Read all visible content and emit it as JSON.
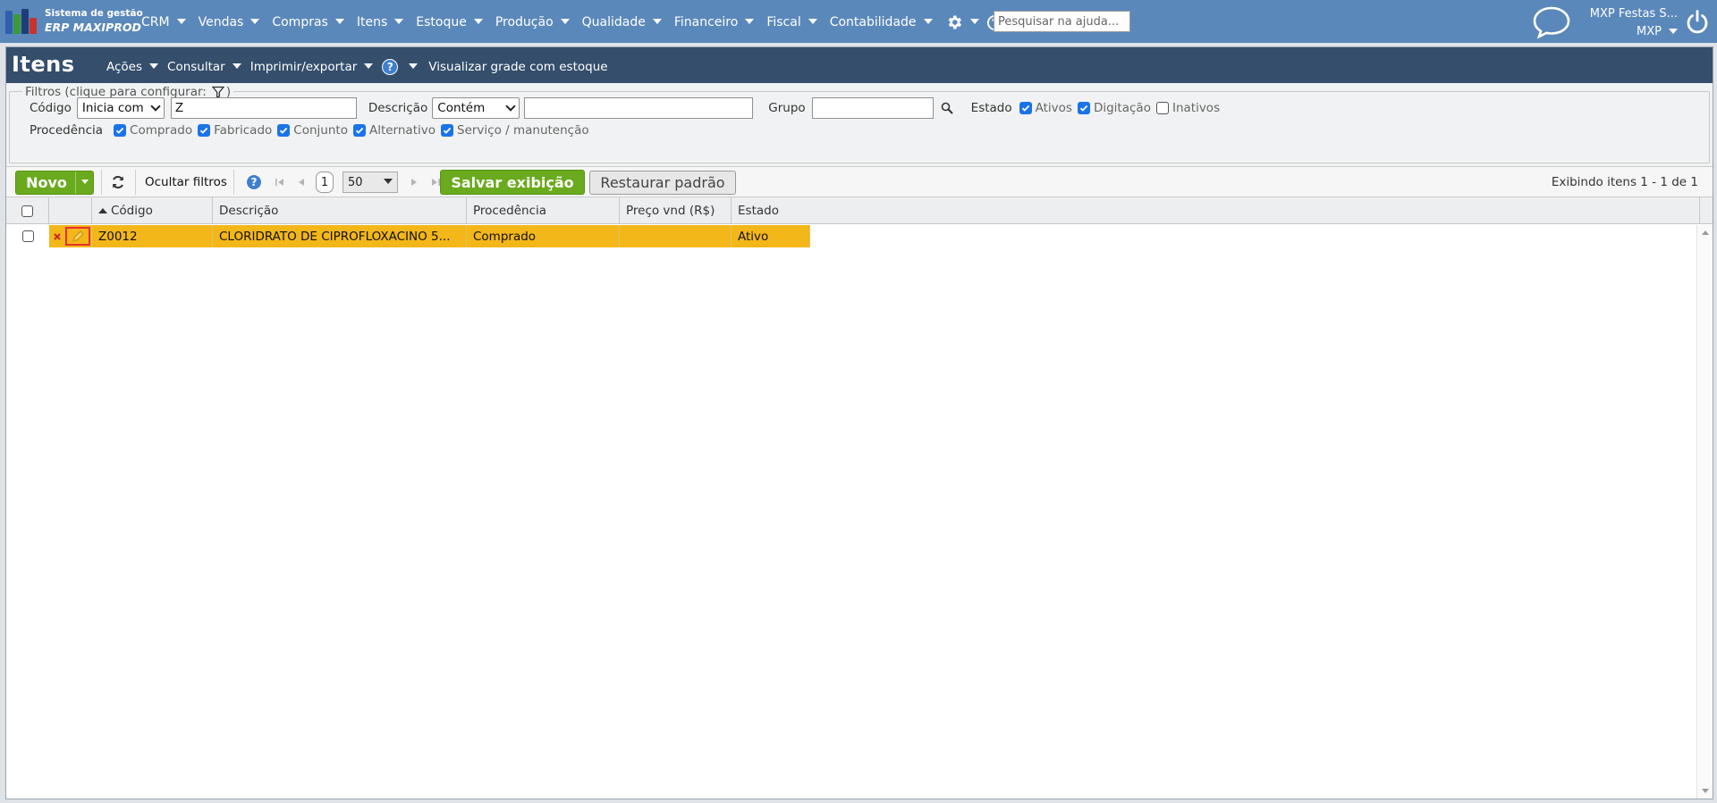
{
  "brand": {
    "line1": "Sistema de gestão",
    "line2": "ERP MAXIPROD"
  },
  "nav": [
    {
      "label": "CRM"
    },
    {
      "label": "Vendas"
    },
    {
      "label": "Compras"
    },
    {
      "label": "Itens"
    },
    {
      "label": "Estoque"
    },
    {
      "label": "Produção"
    },
    {
      "label": "Qualidade"
    },
    {
      "label": "Financeiro"
    },
    {
      "label": "Fiscal"
    },
    {
      "label": "Contabilidade"
    }
  ],
  "help_search": {
    "placeholder": "Pesquisar na ajuda..."
  },
  "user": {
    "company": "MXP Festas S...",
    "account": "MXP"
  },
  "page": {
    "title": "Itens",
    "menu": [
      {
        "label": "Ações"
      },
      {
        "label": "Consultar"
      },
      {
        "label": "Imprimir/exportar"
      }
    ],
    "link": "Visualizar grade com estoque"
  },
  "filters": {
    "legend": "Filtros (clique para configurar:",
    "legend_end": ")",
    "codigo": {
      "label": "Código",
      "mode": "Inicia com",
      "value": "Z"
    },
    "descricao": {
      "label": "Descrição",
      "mode": "Contém",
      "value": ""
    },
    "grupo": {
      "label": "Grupo",
      "value": ""
    },
    "estado": {
      "label": "Estado",
      "options": [
        {
          "label": "Ativos",
          "checked": true
        },
        {
          "label": "Digitação",
          "checked": true
        },
        {
          "label": "Inativos",
          "checked": false
        }
      ]
    },
    "procedencia": {
      "label": "Procedência",
      "options": [
        {
          "label": "Comprado",
          "checked": true
        },
        {
          "label": "Fabricado",
          "checked": true
        },
        {
          "label": "Conjunto",
          "checked": true
        },
        {
          "label": "Alternativo",
          "checked": true
        },
        {
          "label": "Serviço / manutenção",
          "checked": true
        }
      ]
    }
  },
  "toolbar": {
    "novo": "Novo",
    "ocultar": "Ocultar filtros",
    "page": "1",
    "page_size": "50",
    "salvar": "Salvar exibição",
    "restaurar": "Restaurar padrão",
    "exibindo": "Exibindo itens 1 - 1 de 1"
  },
  "grid": {
    "columns": [
      "Código",
      "Descrição",
      "Procedência",
      "Preço vnd (R$)",
      "Estado"
    ],
    "rows": [
      {
        "codigo": "Z0012",
        "descricao": "CLORIDRATO DE CIPROFLOXACINO 5...",
        "procedencia": "Comprado",
        "preco": "",
        "estado": "Ativo"
      }
    ]
  },
  "colors": {
    "topbar": "#5b88ba",
    "titlebar": "#344e6c",
    "accent_green": "#6aaa1e",
    "row_highlight": "#f4b719",
    "checkbox_on": "#1a73e8"
  }
}
